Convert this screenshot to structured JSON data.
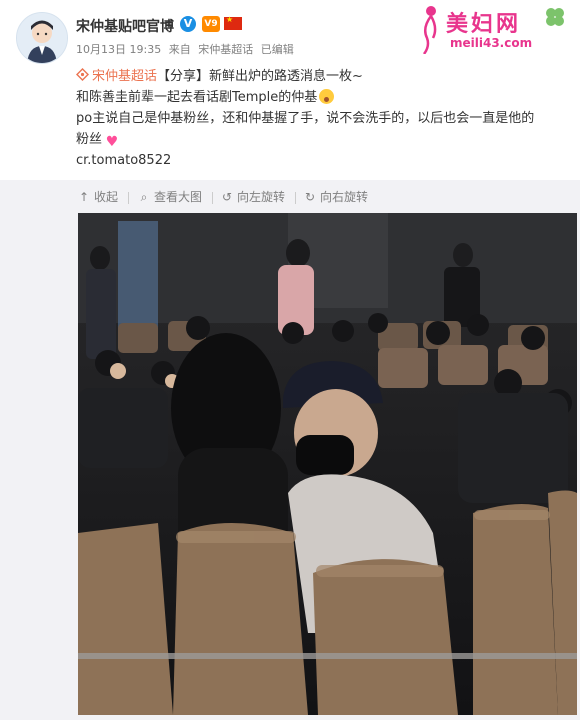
{
  "header": {
    "author_name": "宋仲基贴吧官博",
    "verified_badge": "V",
    "member_badge": "V9",
    "timestamp": "10月13日 19:35",
    "source_prefix": "来自",
    "source": "宋仲基超话",
    "edited": "已编辑"
  },
  "watermark": {
    "text": "美妇网",
    "url": "meili43.com"
  },
  "post": {
    "supertopic": "宋仲基超话",
    "line1_rest": "【分享】新鲜出炉的路透消息一枚~",
    "line2": "和陈善圭前辈一起去看话剧Temple的仲基",
    "line3": "po主说自己是仲基粉丝，还和仲基握了手，说不会洗手的，以后也会一直是他的",
    "line4": "粉丝",
    "credit": "cr.tomato8522"
  },
  "toolbar": {
    "collapse": "收起",
    "view_large": "查看大图",
    "rotate_left": "向左旋转",
    "rotate_right": "向右旋转"
  },
  "icons": [
    "avatar-image",
    "verified-icon",
    "member-icon",
    "flag-icon",
    "supertopic-icon",
    "shock-emoji-icon",
    "heart-emoji-icon",
    "collapse-icon",
    "zoom-icon",
    "rotate-left-icon",
    "rotate-right-icon"
  ],
  "colors": {
    "accent_orange": "#eb7350",
    "meta_gray": "#808080",
    "verified_blue": "#1a8fe3",
    "watermark_pink": "#e8358d",
    "panel_bg": "#f2f2f5"
  }
}
